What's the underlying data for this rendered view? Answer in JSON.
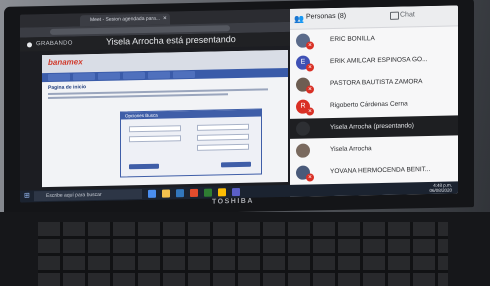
{
  "browser": {
    "tab_title": "Meet - Sesion agendada para...",
    "sharing_label": "GRABANDO",
    "presenter_banner": "Yisela Arrocha está presentando"
  },
  "presentation": {
    "logo": "banamex",
    "content_title": "Pagina de inicio",
    "dialog_title": "Opciones Busca"
  },
  "participants_panel": {
    "people_tab": "Personas (8)",
    "chat_tab": "Chat",
    "participants": [
      {
        "name": "ERIC BONILLA",
        "initial": "",
        "avatar_color": "#5b6b8a",
        "mic_muted": true
      },
      {
        "name": "ERIK AMILCAR ESPINOSA GO...",
        "initial": "E",
        "avatar_color": "#3f51b5",
        "mic_muted": true
      },
      {
        "name": "PASTORA BAUTISTA ZAMORA",
        "initial": "",
        "avatar_color": "#6d5d52",
        "mic_muted": true
      },
      {
        "name": "Rigoberto Cárdenas Cerna",
        "initial": "R",
        "avatar_color": "#d93025",
        "mic_muted": true
      },
      {
        "name": "Yisela Arrocha (presentando)",
        "initial": "",
        "avatar_color": "#2d2f33",
        "mic_muted": false
      },
      {
        "name": "Yisela Arrocha",
        "initial": "",
        "avatar_color": "#7a6a5f",
        "mic_muted": false
      },
      {
        "name": "YOVANA HERMOCENDA BENIT...",
        "initial": "",
        "avatar_color": "#4a5a7a",
        "mic_muted": true
      }
    ]
  },
  "taskbar": {
    "search_placeholder": "Escribe aquí para buscar",
    "time": "4:48 p.m.",
    "date": "06/08/2020"
  },
  "laptop": {
    "brand": "TOSHIBA"
  }
}
